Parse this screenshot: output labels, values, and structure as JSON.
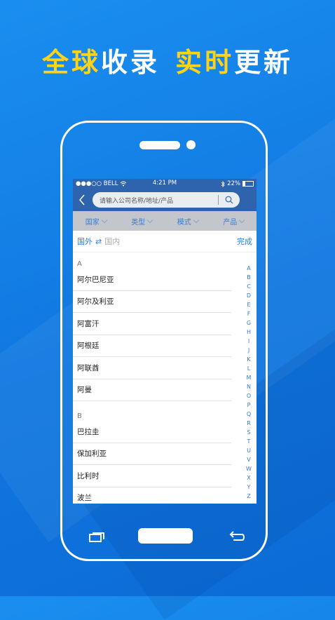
{
  "headline": {
    "part1": "全球",
    "part2": "收录",
    "part3": "实时",
    "part4": "更新"
  },
  "status": {
    "carrier": "●●●○○ BELL",
    "time": "4:21 PM",
    "battery": "22%"
  },
  "search": {
    "placeholder": "请输入公司名称/地址/产品"
  },
  "filters": [
    "国家",
    "类型",
    "模式",
    "产品"
  ],
  "toggle": {
    "foreign": "国外",
    "domestic": "国内",
    "done": "完成"
  },
  "sections": [
    {
      "letter": "A",
      "items": [
        "阿尔巴尼亚",
        "阿尔及利亚",
        "阿富汗",
        "阿根廷",
        "阿联酋",
        "阿曼"
      ]
    },
    {
      "letter": "B",
      "items": [
        "巴拉圭",
        "保加利亚",
        "比利时",
        "波兰"
      ]
    }
  ],
  "index_letters": [
    "A",
    "B",
    "C",
    "D",
    "E",
    "F",
    "G",
    "H",
    "I",
    "J",
    "K",
    "L",
    "M",
    "N",
    "O",
    "P",
    "Q",
    "R",
    "S",
    "T",
    "U",
    "V",
    "W",
    "X",
    "Y",
    "Z"
  ]
}
